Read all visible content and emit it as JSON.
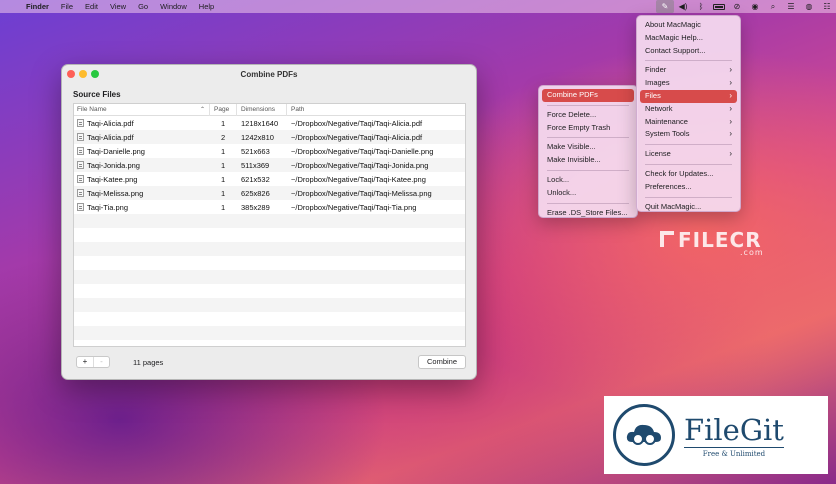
{
  "menubar": {
    "app": "Finder",
    "items": [
      "File",
      "Edit",
      "View",
      "Go",
      "Window",
      "Help"
    ],
    "status_icons": [
      "magic-wand-icon",
      "volume-icon",
      "bluetooth-icon",
      "battery-icon",
      "wifi-off-icon",
      "user-icon",
      "search-icon",
      "control-center-icon",
      "siri-icon",
      "notification-icon"
    ]
  },
  "window": {
    "title": "Combine PDFs",
    "section_label": "Source Files",
    "columns": [
      "File Name",
      "Page",
      "Dimensions",
      "Path"
    ],
    "rows": [
      {
        "name": "Taqi-Alicia.pdf",
        "page": "1",
        "dims": "1218x1640",
        "path": "~/Dropbox/Negative/Taqi/Taqi-Alicia.pdf"
      },
      {
        "name": "Taqi-Alicia.pdf",
        "page": "2",
        "dims": "1242x810",
        "path": "~/Dropbox/Negative/Taqi/Taqi-Alicia.pdf"
      },
      {
        "name": "Taqi-Danielle.png",
        "page": "1",
        "dims": "521x663",
        "path": "~/Dropbox/Negative/Taqi/Taqi-Danielle.png"
      },
      {
        "name": "Taqi-Jonida.png",
        "page": "1",
        "dims": "511x369",
        "path": "~/Dropbox/Negative/Taqi/Taqi-Jonida.png"
      },
      {
        "name": "Taqi-Katee.png",
        "page": "1",
        "dims": "621x532",
        "path": "~/Dropbox/Negative/Taqi/Taqi-Katee.png"
      },
      {
        "name": "Taqi-Melissa.png",
        "page": "1",
        "dims": "625x826",
        "path": "~/Dropbox/Negative/Taqi/Taqi-Melissa.png"
      },
      {
        "name": "Taqi-Tia.png",
        "page": "1",
        "dims": "385x289",
        "path": "~/Dropbox/Negative/Taqi/Taqi-Tia.png"
      }
    ],
    "add_label": "+",
    "remove_label": "-",
    "page_count": "11 pages",
    "combine_label": "Combine"
  },
  "main_menu": {
    "groups": [
      [
        "About MacMagic",
        "MacMagic Help...",
        "Contact Support..."
      ],
      [
        "Finder",
        "Images",
        "Files",
        "Network",
        "Maintenance",
        "System Tools"
      ],
      [
        "License"
      ],
      [
        "Check for Updates...",
        "Preferences..."
      ],
      [
        "Quit MacMagic..."
      ]
    ],
    "submenu_items": [
      "Finder",
      "Images",
      "Files",
      "Network",
      "Maintenance",
      "System Tools",
      "License"
    ],
    "highlighted": "Files"
  },
  "files_menu": {
    "groups": [
      [
        "Combine PDFs"
      ],
      [
        "Force Delete...",
        "Force Empty Trash"
      ],
      [
        "Make Visible...",
        "Make Invisible..."
      ],
      [
        "Lock...",
        "Unlock..."
      ],
      [
        "Erase .DS_Store Files..."
      ]
    ],
    "highlighted": "Combine PDFs"
  },
  "watermarks": {
    "filecr": "FILECR",
    "filecr_suffix": ".com",
    "filegit_title": "FileGit",
    "filegit_subtitle": "Free & Unlimited"
  },
  "colors": {
    "highlight": "#d74b4b",
    "filegit_brand": "#1f4a6e"
  }
}
